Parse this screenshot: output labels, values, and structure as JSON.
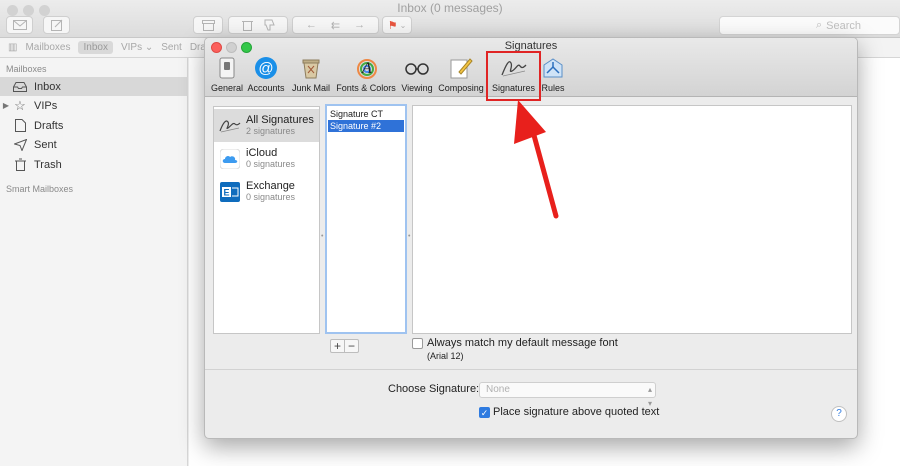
{
  "mail": {
    "title": "Inbox (0 messages)",
    "search_placeholder": "Search",
    "favorites": [
      "Mailboxes",
      "Inbox",
      "VIPs ⌄",
      "Sent",
      "Drafts"
    ],
    "sidebar": {
      "section_mailboxes": "Mailboxes",
      "items": [
        {
          "label": "Inbox",
          "icon": "inbox-icon"
        },
        {
          "label": "VIPs",
          "icon": "star-icon"
        },
        {
          "label": "Drafts",
          "icon": "drafts-icon"
        },
        {
          "label": "Sent",
          "icon": "paper-plane-icon"
        },
        {
          "label": "Trash",
          "icon": "trash-icon"
        }
      ],
      "section_smart": "Smart Mailboxes"
    },
    "background_fragment": "d"
  },
  "prefs": {
    "title": "Signatures",
    "toolbar": [
      {
        "label": "General",
        "icon": "switch-icon"
      },
      {
        "label": "Accounts",
        "icon": "at-sign-icon"
      },
      {
        "label": "Junk Mail",
        "icon": "junk-mail-icon"
      },
      {
        "label": "Fonts & Colors",
        "icon": "fonts-colors-icon"
      },
      {
        "label": "Viewing",
        "icon": "glasses-icon"
      },
      {
        "label": "Composing",
        "icon": "pencil-icon"
      },
      {
        "label": "Signatures",
        "icon": "signature-icon"
      },
      {
        "label": "Rules",
        "icon": "rules-icon"
      }
    ],
    "accounts": [
      {
        "name": "All Signatures",
        "count": "2 signatures",
        "icon": "signature-icon"
      },
      {
        "name": "iCloud",
        "count": "0 signatures",
        "icon": "icloud-icon"
      },
      {
        "name": "Exchange",
        "count": "0 signatures",
        "icon": "exchange-icon"
      }
    ],
    "signatures": [
      "Signature CT",
      "Signature #2"
    ],
    "add_label": "+",
    "remove_label": "−",
    "match_font_label": "Always match my default message font",
    "font_hint": "(Arial 12)",
    "choose_signature_label": "Choose Signature:",
    "choose_signature_value": "None",
    "place_above_label": "Place signature above quoted text",
    "help_label": "?"
  },
  "colors": {
    "highlight": "#e02424",
    "selection": "#2f72d8",
    "accent": "#2f7be0"
  }
}
